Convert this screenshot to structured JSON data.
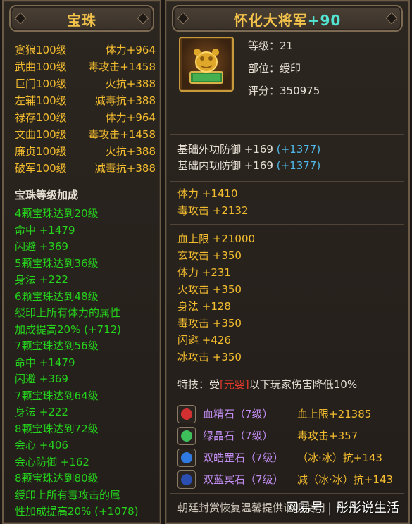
{
  "left_panel": {
    "title": "宝珠",
    "beads": [
      {
        "name": "贪狼100级",
        "effect": "体力+964"
      },
      {
        "name": "武曲100级",
        "effect": "毒攻击+1458"
      },
      {
        "name": "巨门100级",
        "effect": "火抗+388"
      },
      {
        "name": "左辅100级",
        "effect": "减毒抗+388"
      },
      {
        "name": "禄存100级",
        "effect": "体力+964"
      },
      {
        "name": "文曲100级",
        "effect": "毒攻击+1458"
      },
      {
        "name": "廉贞100级",
        "effect": "火抗+388"
      },
      {
        "name": "破军100级",
        "effect": "减毒抗+388"
      }
    ],
    "bonus_heading": "宝珠等级加成",
    "bonus_lines": [
      "4颗宝珠达到20级",
      "命中 +1479",
      "闪避 +369",
      "5颗宝珠达到36级",
      "身法 +222",
      "6颗宝珠达到48级",
      "绶印上所有体力的属性",
      "加成提高20% (+712)",
      "7颗宝珠达到56级",
      "命中 +1479",
      "闪避 +369",
      "7颗宝珠达到64级",
      "身法 +222",
      "8颗宝珠达到72级",
      "会心 +406",
      "会心防御 +162",
      "8颗宝珠达到80级",
      "绶印上所有毒攻击的属",
      "性加成提高20% (+1078)"
    ]
  },
  "right_panel": {
    "title": "怀化大将军",
    "title_bonus": "+90",
    "item": {
      "level_label": "等级：21",
      "slot_label": "部位：绶印",
      "score_label": "评分：350975"
    },
    "base_defense": [
      {
        "text": "基础外功防御 +169",
        "bonus": "(+1377)"
      },
      {
        "text": "基础内功防御 +169",
        "bonus": "(+1377)"
      }
    ],
    "main_stats": [
      "体力 +1410",
      "毒攻击 +2132"
    ],
    "extra_stats": [
      "血上限 +21000",
      "玄攻击 +350",
      "体力 +231",
      "火攻击 +350",
      "身法 +128",
      "毒攻击 +350",
      "闪避 +426",
      "冰攻击 +350"
    ],
    "skill": {
      "prefix": "特技：受",
      "highlight": "[元婴]",
      "suffix": "以下玩家伤害降低10%"
    },
    "gems": [
      {
        "name": "血精石（7级）",
        "effect": "血上限+21385",
        "icon": "red-gem-icon",
        "color": "#d23030"
      },
      {
        "name": "绿晶石（7级）",
        "effect": "毒攻击+357",
        "icon": "green-gem-icon",
        "color": "#3ec05a"
      },
      {
        "name": "双皓罡石（7级）",
        "effect": "（冰·冰）抗+143",
        "icon": "blue-gem-icon",
        "color": "#2f7ae0"
      },
      {
        "name": "双蓝冥石（7级）",
        "effect": "减（冰·冰）抗+143",
        "icon": "dark-blue-gem-icon",
        "color": "#2a4fb0"
      }
    ],
    "footer_text": "朝廷封赏恢复温馨提供证明使用"
  },
  "watermark": "网易号 | 彤彤说生活"
}
